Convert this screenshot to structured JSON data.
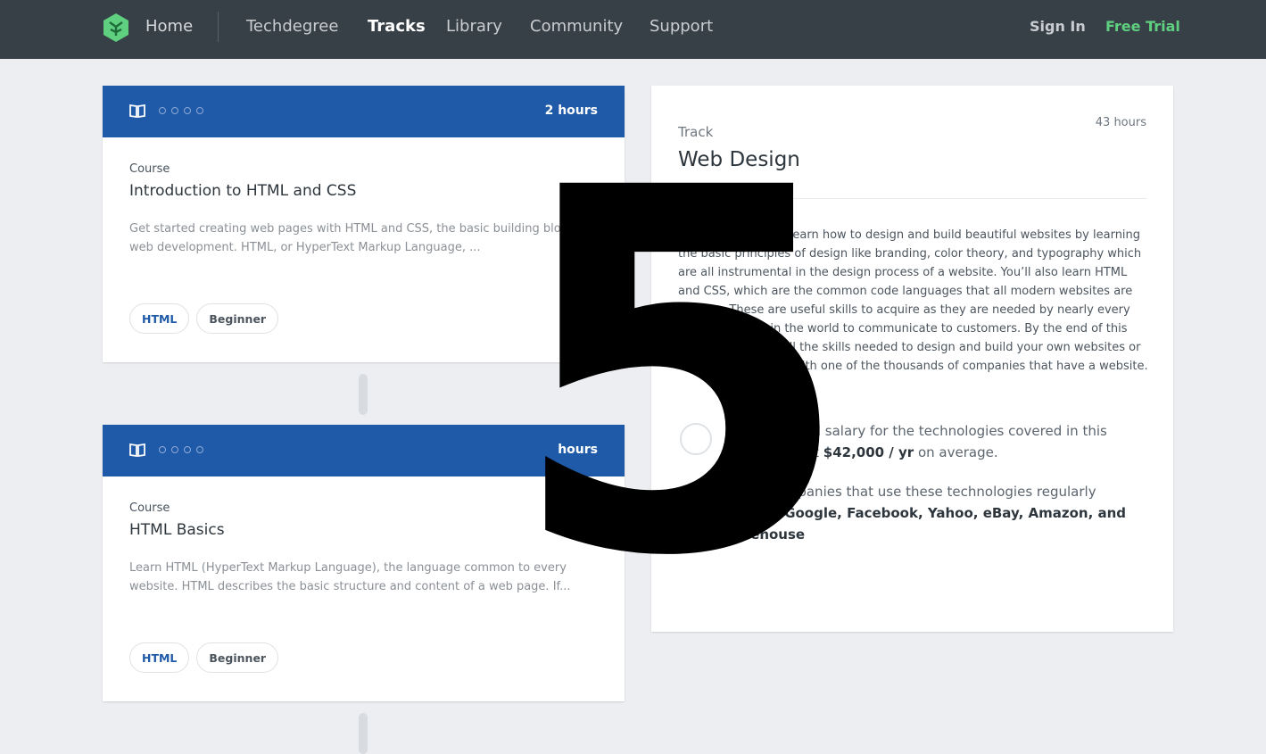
{
  "nav": {
    "home": "Home",
    "links": [
      "Techdegree",
      "Tracks",
      "Library",
      "Community",
      "Support"
    ],
    "active": "Tracks",
    "signin": "Sign In",
    "trial": "Free Trial"
  },
  "courses": [
    {
      "duration": "2 hours",
      "label": "Course",
      "title": "Introduction to HTML and CSS",
      "desc": "Get started creating web pages with HTML and CSS, the basic building blocks of web development. HTML, or HyperText Markup Language, ...",
      "tags": [
        "HTML",
        "Beginner"
      ]
    },
    {
      "duration": "hours",
      "label": "Course",
      "title": "HTML Basics",
      "desc": "Learn HTML (HyperText Markup Language), the language common to every website. HTML describes the basic structure and content of a web page. If...",
      "tags": [
        "HTML",
        "Beginner"
      ]
    }
  ],
  "track": {
    "label": "Track",
    "title": "Web Design",
    "hours": "43 hours",
    "desc": "In this track, you’ll learn how to design and build beautiful websites by learning the basic principles of design like branding, color theory, and typography which are all instrumental in the design process of a website. You’ll also learn HTML and CSS, which are the common code languages that all modern websites are built on. These are useful skills to acquire as they are needed by nearly every single business in the world to communicate to customers. By the end of this track, you’ll have all the skills needed to design and build your own websites or even start a career with one of the thousands of companies that have a website.",
    "salary_prefix": "An entry-level salary for the technologies covered in this track is about",
    "salary_value": "$42,000 / yr",
    "salary_suffix": "on average.",
    "companies_prefix": "Some companies that use these technologies regularly include:",
    "companies_value": "Google, Facebook, Yahoo, eBay, Amazon, and Treehouse"
  },
  "overlay": "5",
  "colors": {
    "nav_bg": "#384047",
    "card_head": "#1e5aa8",
    "accent_green": "#5fcf80"
  }
}
